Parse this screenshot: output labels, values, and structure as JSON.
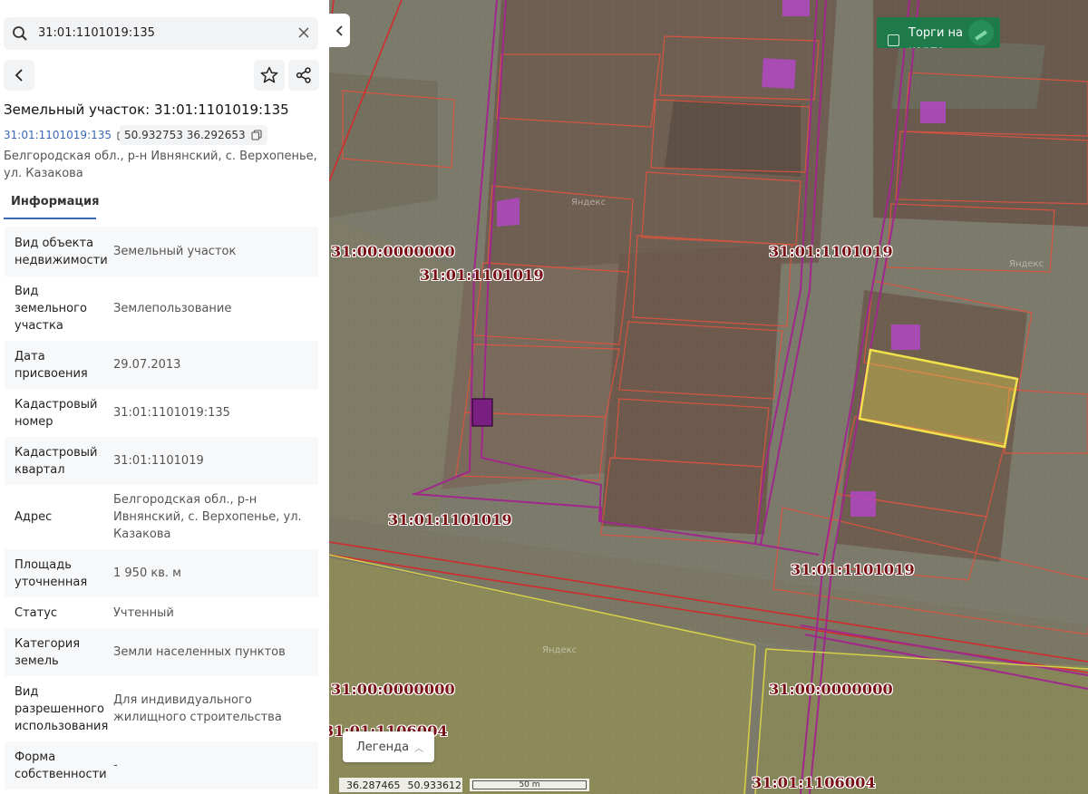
{
  "search": {
    "value": "31:01:1101019:135"
  },
  "object": {
    "title": "Земельный участок: 31:01:1101019:135",
    "cadastral_number": "31:01:1101019:135",
    "coordinates": "50.932753 36.292653",
    "address": "Белгородская обл., р-н Ивнянский, с. Верхопенье, ул. Казакова"
  },
  "tabs": [
    {
      "label": "Информация"
    }
  ],
  "info_rows": [
    {
      "key": "Вид объекта недвижимости",
      "value": "Земельный участок"
    },
    {
      "key": "Вид земельного участка",
      "value": "Землепользование"
    },
    {
      "key": "Дата присвоения",
      "value": "29.07.2013"
    },
    {
      "key": "Кадастровый номер",
      "value": "31:01:1101019:135"
    },
    {
      "key": "Кадастровый квартал",
      "value": "31:01:1101019"
    },
    {
      "key": "Адрес",
      "value": "Белгородская обл., р-н Ивнянский, с. Верхопенье, ул. Казакова"
    },
    {
      "key": "Площадь уточненная",
      "value": "1 950 кв. м"
    },
    {
      "key": "Статус",
      "value": "Учтенный"
    },
    {
      "key": "Категория земель",
      "value": "Земли населенных пунктов"
    },
    {
      "key": "Вид разрешенного использования",
      "value": "Для индивидуального жилищного строительства"
    },
    {
      "key": "Форма собственности",
      "value": "-"
    }
  ],
  "map": {
    "torgi_label": "Торги на карте",
    "legend_label": "Легенда",
    "cursor_coords": {
      "lon": "36.287465",
      "lat": "50.933612"
    },
    "scale_label": "50 m",
    "watermark": "Яндекс",
    "quarter_labels": [
      "31:00:0000000",
      "31:01:1101019",
      "31:01:1101019",
      "31:01:1101019",
      "31:01:1101019",
      "31:00:0000000",
      "31:00:0000000",
      "31:01:1106004",
      "31:01:1106004"
    ],
    "colors": {
      "parcel_outline": "#e0533f",
      "quarter_outline": "#a0288c",
      "selected_parcel": "#f2e14a",
      "label_text": "#7a1015"
    }
  }
}
